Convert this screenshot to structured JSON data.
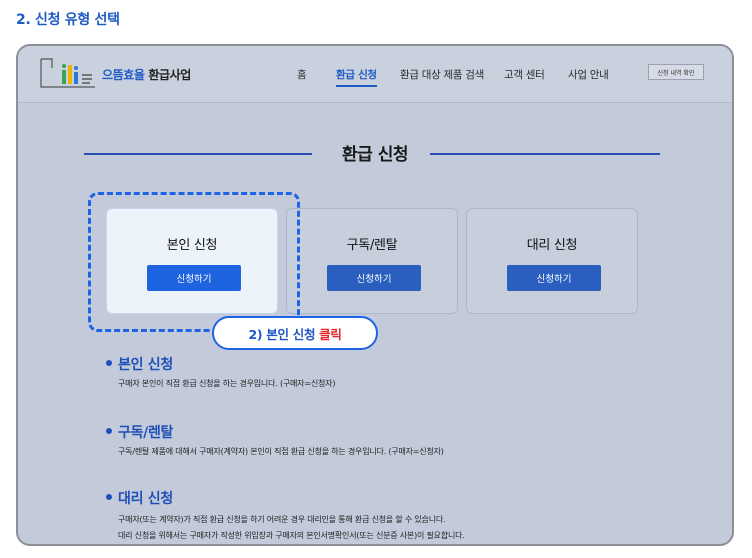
{
  "step_title": "2. 신청 유형 선택",
  "header": {
    "brand_blue": "으뜸효율",
    "brand_rest": " 환급사업",
    "menu": [
      "홈",
      "환급 신청",
      "환급 대상 제품 검색",
      "고객 센터",
      "사업 안내"
    ],
    "active_index": 1,
    "history_button": "신청 내역 확인"
  },
  "section_title": "환급 신청",
  "cards": [
    {
      "name": "본인 신청",
      "button": "신청하기",
      "selected": true
    },
    {
      "name": "구독/렌탈",
      "button": "신청하기",
      "selected": false
    },
    {
      "name": "대리 신청",
      "button": "신청하기",
      "selected": false
    }
  ],
  "callout": {
    "text": "2) 본인 신청",
    "action": "클릭"
  },
  "info": [
    {
      "title": "본인 신청",
      "lines": [
        "구매자 본인이 직접 환급 신청을 하는 경우입니다. (구매자=신청자)"
      ]
    },
    {
      "title": "구독/렌탈",
      "lines": [
        "구독/렌탈 제품에 대해서 구매자(계약자) 본인이 직접 환급 신청을 하는 경우입니다. (구매자=신청자)"
      ]
    },
    {
      "title": "대리 신청",
      "lines": [
        "구매자(또는 계약자)가 직접 환급 신청을 하기 어려운 경우 대리인을 통해 환급 신청을 할 수 있습니다.",
        "대리 신청을 위해서는 구매자가 작성한 위임장과 구매자의 본인서명확인서(또는 신분증 사본)이 필요합니다."
      ]
    }
  ],
  "colors": {
    "accent": "#1f63e6",
    "title_blue": "#1f5cc6",
    "highlight_red": "#e5262b"
  }
}
